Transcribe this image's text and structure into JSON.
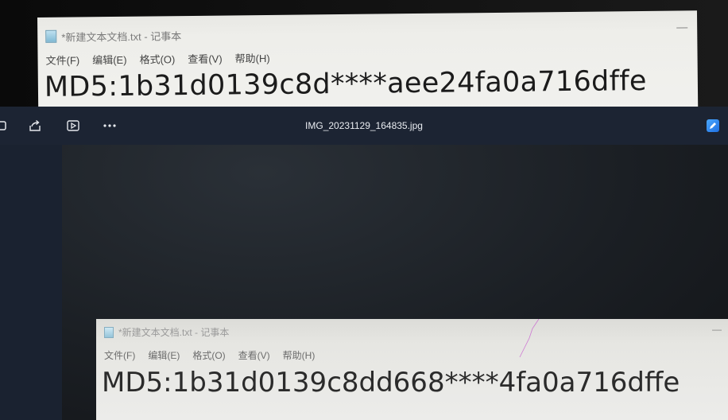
{
  "top_notepad": {
    "title": "*新建文本文档.txt - 记事本",
    "menu": [
      "文件(F)",
      "编辑(E)",
      "格式(O)",
      "查看(V)",
      "帮助(H)"
    ],
    "content": "MD5:1b31d0139c8d****aee24fa0a716dffe"
  },
  "viewer": {
    "filename": "IMG_20231129_164835.jpg",
    "toolbar_icons": [
      "rotate-icon",
      "share-icon",
      "slideshow-icon",
      "more-icon",
      "edit-icon"
    ]
  },
  "bottom_notepad": {
    "title": "*新建文本文档.txt - 记事本",
    "menu": [
      "文件(F)",
      "编辑(E)",
      "格式(O)",
      "查看(V)",
      "帮助(H)"
    ],
    "content": "MD5:1b31d0139c8dd668****4fa0a716dffe"
  },
  "colors": {
    "toolbar_bg": "#1c2433",
    "accent": "#1f6fe0",
    "notepad_paper": "#eeeeea"
  }
}
